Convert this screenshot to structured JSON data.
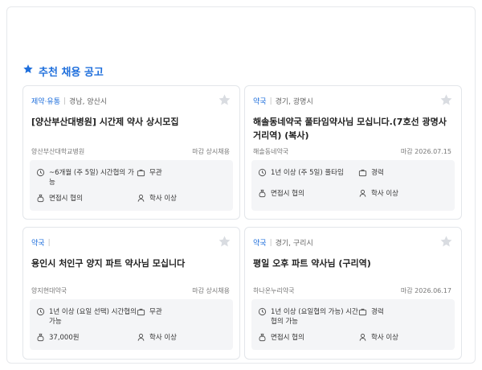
{
  "section": {
    "title": "추천 채용 공고",
    "icon": "star-icon"
  },
  "colors": {
    "accent": "#1f6fdc",
    "card_border": "#e3e6ea",
    "info_bg": "#f4f5f7",
    "star": "#d9dce1"
  },
  "cards": [
    {
      "category": "제약·유통",
      "location": "경남, 양산시",
      "title": "[양산부산대병원] 시간제 약사 상시모집",
      "company": "양산부산대학교병원",
      "deadline": "마감 상시채용",
      "experience": "~6개월 (주 5일) 시간협의 가능",
      "employment": "무관",
      "salary": "면접시 협의",
      "education": "학사 이상"
    },
    {
      "category": "약국",
      "location": "경기, 광명시",
      "title": "해솔동네약국 풀타임약사님 모십니다.(7호선 광명사거리역) (복사)",
      "company": "해솔동네약국",
      "deadline": "마감 2026.07.15",
      "experience": "1년 이상 (주 5일) 풀타임",
      "employment": "경력",
      "salary": "면접시 협의",
      "education": "학사 이상"
    },
    {
      "category": "약국",
      "location": "",
      "title": "용인시 처인구 양지 파트 약사님 모십니다",
      "company": "양지현대약국",
      "deadline": "마감 상시채용",
      "experience": "1년 이상 (요일 선택) 시간협의 가능",
      "employment": "무관",
      "salary": "37,000원",
      "education": "학사 이상"
    },
    {
      "category": "약국",
      "location": "경기, 구리시",
      "title": "평일 오후 파트 약사님 (구리역)",
      "company": "하나온누리약국",
      "deadline": "마감 2026.06.17",
      "experience": "1년 이상 (요일협의 가능) 시간협의 가능",
      "employment": "경력",
      "salary": "면접시 협의",
      "education": "학사 이상"
    }
  ]
}
